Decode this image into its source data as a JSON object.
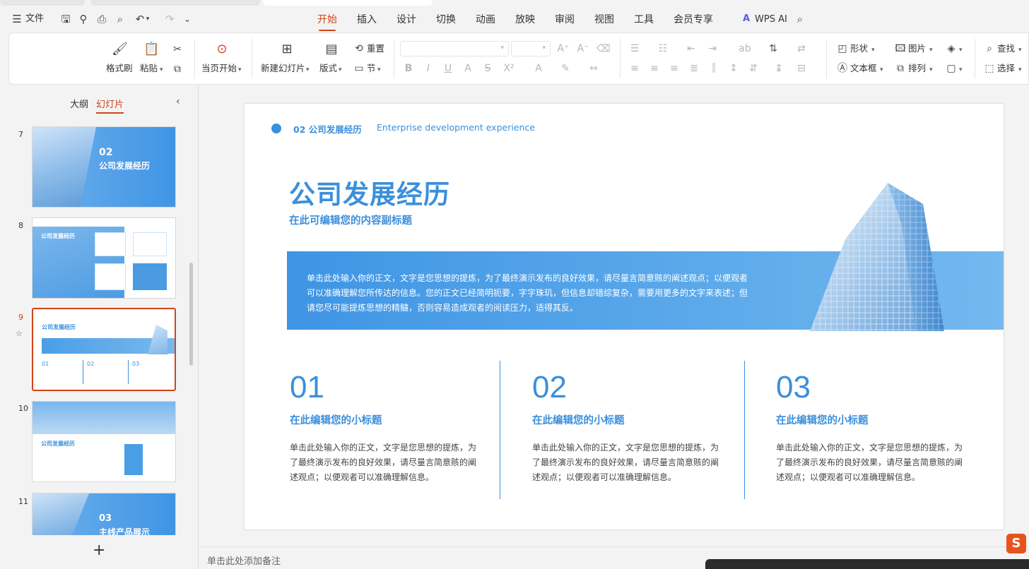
{
  "colors": {
    "accent": "#d0451b",
    "slide_blue": "#3b8fdc",
    "banner_blue": "#4a9ee6"
  },
  "topbar": {
    "menu_label": "文件",
    "tabs": [
      "开始",
      "插入",
      "设计",
      "切换",
      "动画",
      "放映",
      "审阅",
      "视图",
      "工具",
      "会员专享"
    ],
    "active_tab": "开始",
    "wps_ai": "WPS AI"
  },
  "ribbon": {
    "format_painter": "格式刷",
    "paste": "粘贴",
    "play_from_current": "当页开始",
    "new_slide": "新建幻灯片",
    "layout": "版式",
    "reset": "重置",
    "section": "节",
    "shape": "形状",
    "picture": "图片",
    "textbox": "文本框",
    "arrange": "排列",
    "find": "查找",
    "select": "选择"
  },
  "leftpane": {
    "tab_outline": "大纲",
    "tab_slides": "幻灯片",
    "slides": [
      {
        "num": "7",
        "big": "02",
        "title": "公司发展经历"
      },
      {
        "num": "8",
        "title": "公司发展经历"
      },
      {
        "num": "9",
        "title": "公司发展经历",
        "items": [
          "01",
          "02",
          "03"
        ]
      },
      {
        "num": "10",
        "title": "公司发展经历"
      },
      {
        "num": "11",
        "big": "03",
        "title": "主线产品展示"
      }
    ],
    "add": "+"
  },
  "slide": {
    "section": "02 公司发展经历",
    "section_en": "Enterprise development experience",
    "title": "公司发展经历",
    "subtitle": "在此可编辑您的内容副标题",
    "banner_text": "单击此处输入你的正文，文字是您思想的提炼，为了最终演示发布的良好效果，请尽量言简意赅的阐述观点；以便观者可以准确理解您所传达的信息。您的正文已经简明扼要，字字珠玑，但信息却错综复杂，需要用更多的文字来表述；但请您尽可能提炼思想的精髓，否则容易造成观者的阅读压力，适得其反。",
    "columns": [
      {
        "num": "01",
        "heading": "在此编辑您的小标题",
        "text": "单击此处输入你的正文，文字是您思想的提炼，为了最终演示发布的良好效果，请尽量言简意赅的阐述观点；以便观者可以准确理解信息。"
      },
      {
        "num": "02",
        "heading": "在此编辑您的小标题",
        "text": "单击此处输入你的正文，文字是您思想的提炼，为了最终演示发布的良好效果，请尽量言简意赅的阐述观点；以便观者可以准确理解信息。"
      },
      {
        "num": "03",
        "heading": "在此编辑您的小标题",
        "text": "单击此处输入你的正文，文字是您思想的提炼，为了最终演示发布的良好效果，请尽量言简意赅的阐述观点；以便观者可以准确理解信息。"
      }
    ]
  },
  "notes": {
    "placeholder": "单击此处添加备注"
  }
}
